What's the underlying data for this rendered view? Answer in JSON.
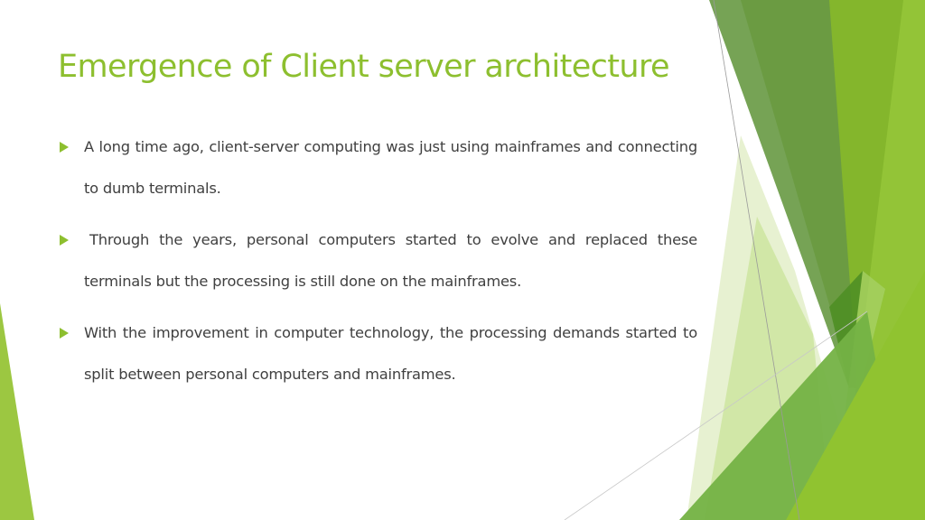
{
  "slide": {
    "title": "Emergence of Client server architecture",
    "bullets": [
      {
        "text": "A long time ago, client-server computing was just using mainframes and connecting to dumb terminals."
      },
      {
        "text": "Through the years, personal computers started to evolve and replaced these terminals but the processing is still done on the mainframes."
      },
      {
        "text": "With the improvement in computer technology, the processing demands started to split between personal computers and mainframes."
      }
    ],
    "colors": {
      "accent": "#8dbf2f",
      "body_text": "#404040",
      "facet_dark": "#6a9a40",
      "facet_mid": "#84b62c",
      "facet_bright": "#93c437",
      "facet_light": "#cde5a0",
      "facet_pale": "#e4f0cc"
    },
    "bullet_icon": "triangle-right-icon"
  }
}
